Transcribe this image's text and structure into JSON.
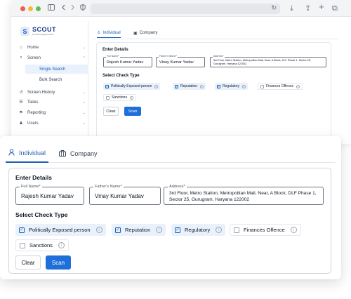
{
  "browser": {
    "sidebar_toggle_icon": "sidebar-icon",
    "back_icon": "chevron-left-icon",
    "forward_icon": "chevron-right-icon",
    "shield_icon": "privacy-shield-icon",
    "reload_glyph": "↻",
    "download_glyph": "⤓",
    "share_glyph": "⇪",
    "newtab_glyph": "+",
    "tabs_glyph": "⧉"
  },
  "app": {
    "logo_letter": "S",
    "logo_name": "SCOUT",
    "logo_sub": "by Technology Product"
  },
  "sidebar": {
    "items": [
      {
        "label": "Home",
        "icon": "⌂"
      },
      {
        "label": "Screen",
        "icon": "⌕"
      },
      {
        "label": "Single Search"
      },
      {
        "label": "Bulk Search"
      },
      {
        "label": "Screen History",
        "icon": "↺"
      },
      {
        "label": "Tasks",
        "icon": "☰"
      },
      {
        "label": "Reporting",
        "icon": "⚑"
      },
      {
        "label": "Users",
        "icon": "♟"
      }
    ]
  },
  "tabs": {
    "individual": "Individual",
    "company": "Company"
  },
  "form": {
    "section_title": "Enter Details",
    "full_name_label": "Full Name*",
    "full_name_value": "Rajesh Kumar Yadav",
    "father_label": "Father's Name*",
    "father_value": "Vinay Kumar Yadav",
    "address_label": "Address*",
    "address_value": "3rd Floor, Metro Station, Metropolitan Mall, Near, A Block, DLF Phase 1, Sector 25, Gurugram, Haryana 122002"
  },
  "checks": {
    "title": "Select Check Type",
    "pep": "Politically Exposed person",
    "reputation": "Reputation",
    "regulatory": "Regulatory",
    "finances": "Finances Offence",
    "sanctions": "Sanctions"
  },
  "buttons": {
    "clear": "Clear",
    "scan": "Scan"
  },
  "colors": {
    "accent": "#1e6fd9",
    "selected_bg": "#e8f1fc"
  }
}
